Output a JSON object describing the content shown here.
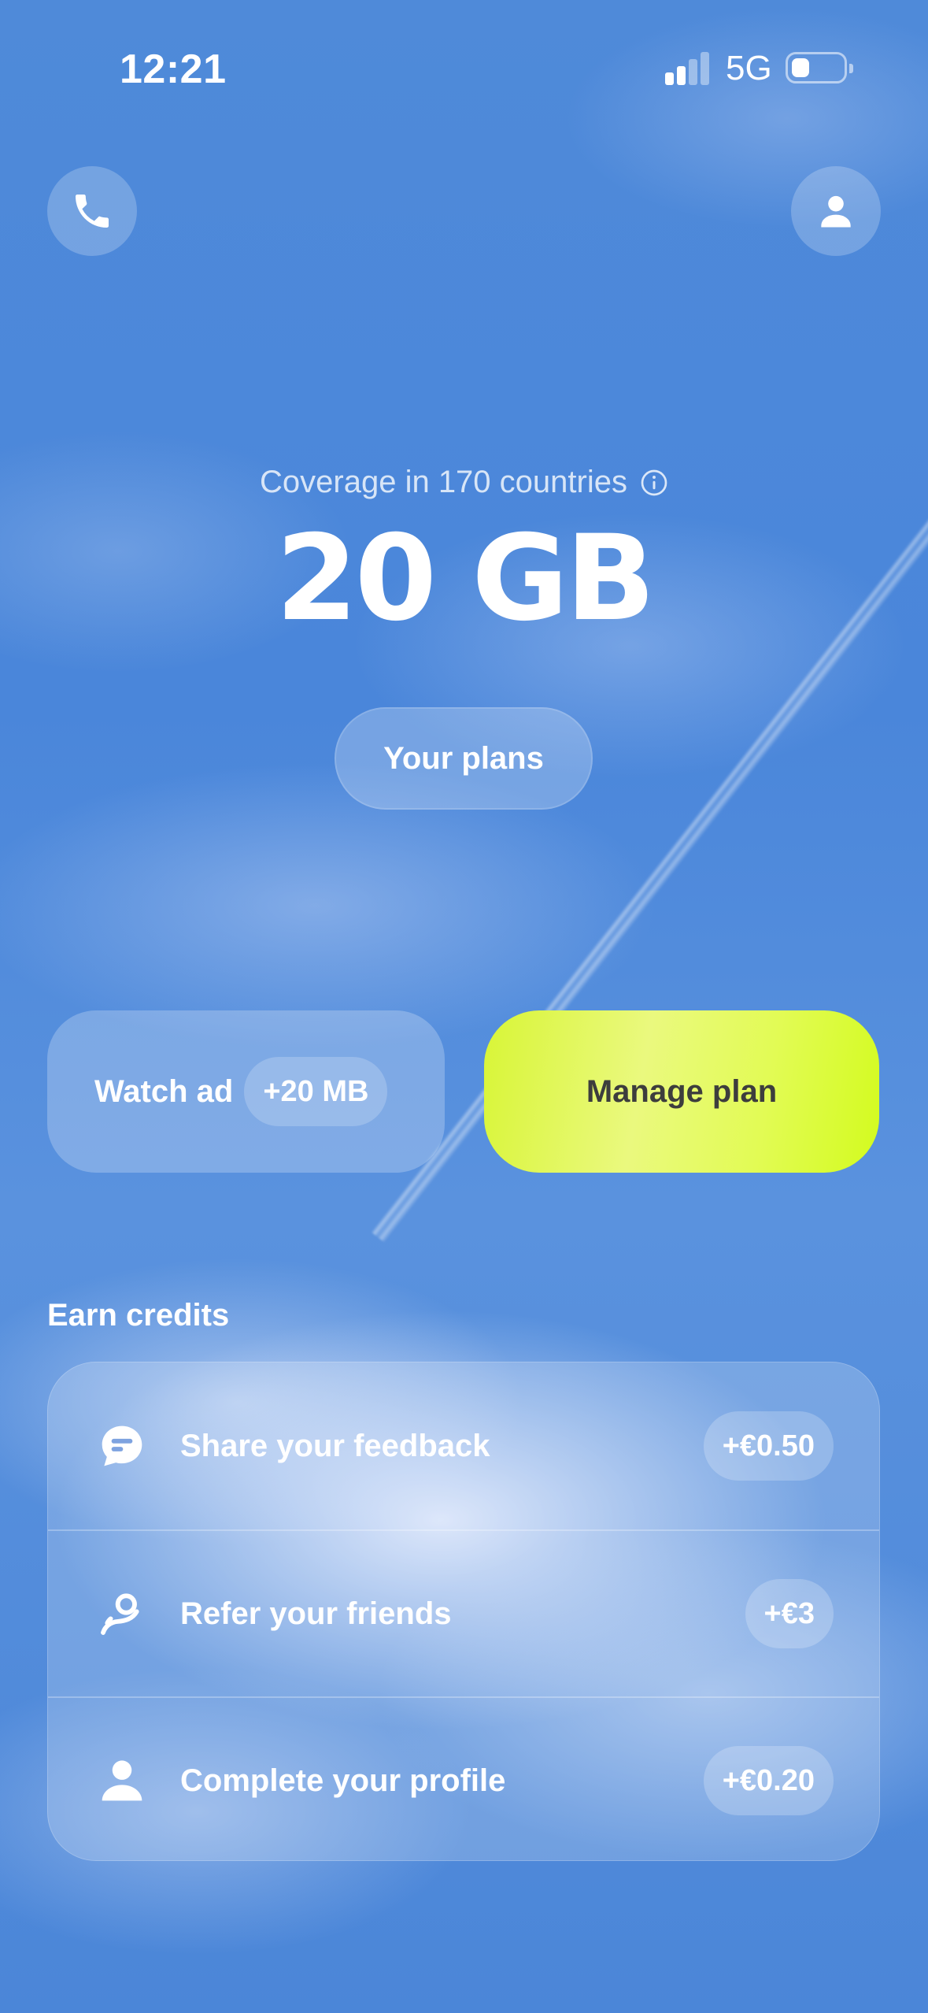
{
  "status_bar": {
    "time": "12:21",
    "network": "5G"
  },
  "header": {
    "left_icon": "phone-icon",
    "right_icon": "user-icon"
  },
  "hero": {
    "coverage": "Coverage in 170 countries",
    "data_amount": "20 GB",
    "plans_button": "Your plans"
  },
  "actions": {
    "watch_ad_label": "Watch ad",
    "watch_ad_reward": "+20 MB",
    "manage_plan_label": "Manage plan",
    "manage_plan_color": "#dcfa3c"
  },
  "earn_credits": {
    "title": "Earn credits",
    "items": [
      {
        "icon": "chat-bubble-icon",
        "label": "Share your feedback",
        "reward": "+€0.50"
      },
      {
        "icon": "refer-friend-icon",
        "label": "Refer your friends",
        "reward": "+€3"
      },
      {
        "icon": "profile-icon",
        "label": "Complete your profile",
        "reward": "+€0.20"
      }
    ]
  }
}
